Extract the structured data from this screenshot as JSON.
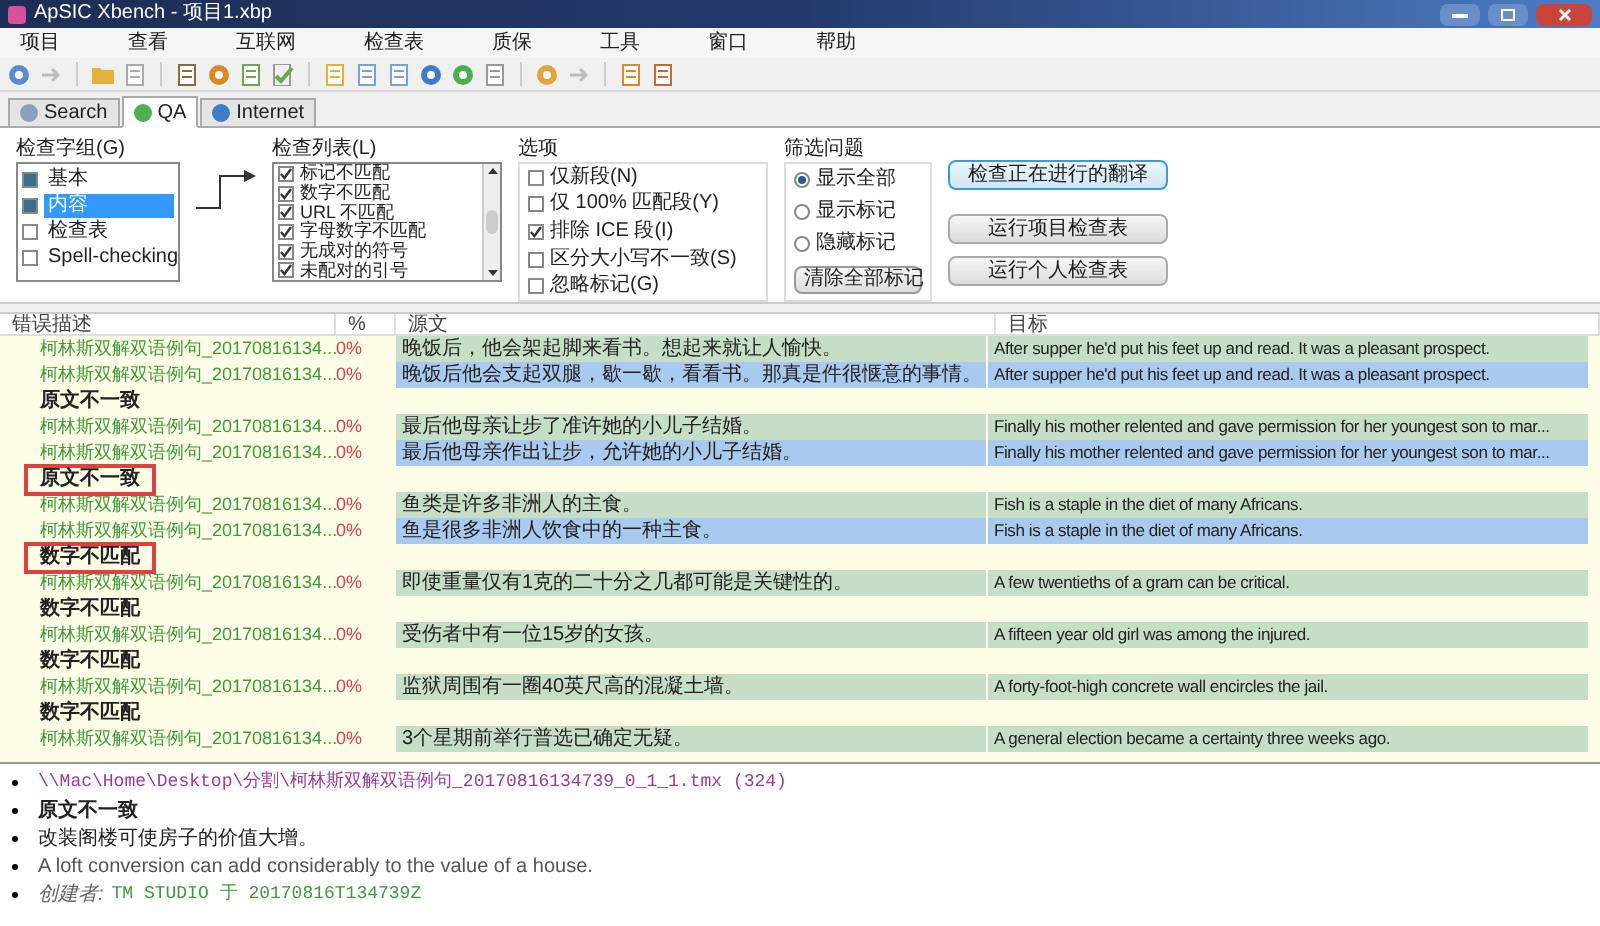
{
  "window": {
    "title": "ApSIC Xbench - 项目1.xbp"
  },
  "menu": [
    "项目",
    "查看",
    "互联网",
    "检查表",
    "质保",
    "工具",
    "窗口",
    "帮助"
  ],
  "tabs": [
    {
      "label": "Search",
      "selected": false
    },
    {
      "label": "QA",
      "selected": true
    },
    {
      "label": "Internet",
      "selected": false
    }
  ],
  "check_groups": {
    "label": "检查字组(G)",
    "items": [
      {
        "label": "基本",
        "checked": true,
        "selected": false
      },
      {
        "label": "内容",
        "checked": true,
        "selected": true
      },
      {
        "label": "检查表",
        "checked": false,
        "selected": false
      },
      {
        "label": "Spell-checking",
        "checked": false,
        "selected": false
      }
    ]
  },
  "check_list": {
    "label": "检查列表(L)",
    "items": [
      {
        "label": "标记不匹配",
        "checked": true
      },
      {
        "label": "数字不匹配",
        "checked": true
      },
      {
        "label": "URL 不匹配",
        "checked": true
      },
      {
        "label": "字母数字不匹配",
        "checked": true
      },
      {
        "label": "无成对的符号",
        "checked": true
      },
      {
        "label": "未配对的引号",
        "checked": true
      }
    ]
  },
  "options": {
    "label": "选项",
    "items": [
      {
        "label": "仅新段(N)",
        "checked": false
      },
      {
        "label": "仅 100% 匹配段(Y)",
        "checked": false
      },
      {
        "label": "排除 ICE 段(I)",
        "checked": true
      },
      {
        "label": "区分大小写不一致(S)",
        "checked": false
      },
      {
        "label": "忽略标记(G)",
        "checked": false
      }
    ]
  },
  "filter": {
    "label": "筛选问题",
    "items": [
      {
        "label": "显示全部",
        "selected": true
      },
      {
        "label": "显示标记",
        "selected": false
      },
      {
        "label": "隐藏标记",
        "selected": false
      }
    ],
    "clear_button": "清除全部标记"
  },
  "actions": [
    {
      "label": "检查正在进行的翻译",
      "focused": true
    },
    {
      "label": "运行项目检查表",
      "focused": false
    },
    {
      "label": "运行个人检查表",
      "focused": false
    }
  ],
  "table": {
    "columns": [
      "错误描述",
      "%",
      "源文",
      "目标"
    ],
    "rows": [
      {
        "kind": "segment",
        "file": "柯林斯双解双语例句_20170816134...",
        "percent": "0%",
        "source": "晚饭后，他会架起脚来看书。想起来就让人愉快。",
        "target": "After supper he'd put his feet up and read. It was a pleasant prospect.",
        "color": "#c7dec6"
      },
      {
        "kind": "segment",
        "file": "柯林斯双解双语例句_20170816134...",
        "percent": "0%",
        "source": "晚饭后他会支起双腿，歇一歇，看看书。那真是件很惬意的事情。",
        "target": "After supper he'd put his feet up and read. It was a pleasant prospect.",
        "color": "#a9c9ee"
      },
      {
        "kind": "group",
        "label": "原文不一致",
        "boxed": false
      },
      {
        "kind": "segment",
        "file": "柯林斯双解双语例句_20170816134...",
        "percent": "0%",
        "source": "最后他母亲让步了准许她的小儿子结婚。",
        "target": "Finally his mother relented and gave permission for her youngest son to mar...",
        "color": "#c7dec6"
      },
      {
        "kind": "segment",
        "file": "柯林斯双解双语例句_20170816134...",
        "percent": "0%",
        "source": "最后他母亲作出让步，允许她的小儿子结婚。",
        "target": "Finally his mother relented and gave permission for her youngest son to mar...",
        "color": "#a9c9ee"
      },
      {
        "kind": "group",
        "label": "原文不一致",
        "boxed": true
      },
      {
        "kind": "segment",
        "file": "柯林斯双解双语例句_20170816134...",
        "percent": "0%",
        "source": "鱼类是许多非洲人的主食。",
        "target": "Fish is a staple in the diet of many Africans.",
        "color": "#c7dec6"
      },
      {
        "kind": "segment",
        "file": "柯林斯双解双语例句_20170816134...",
        "percent": "0%",
        "source": "鱼是很多非洲人饮食中的一种主食。",
        "target": "Fish is a staple in the diet of many Africans.",
        "color": "#a9c9ee"
      },
      {
        "kind": "group",
        "label": "数字不匹配",
        "boxed": true
      },
      {
        "kind": "segment",
        "file": "柯林斯双解双语例句_20170816134...",
        "percent": "0%",
        "source": "即使重量仅有1克的二十分之几都可能是关键性的。",
        "target": "A few twentieths of a gram can be critical.",
        "color": "#c7dec6"
      },
      {
        "kind": "group",
        "label": "数字不匹配",
        "boxed": false
      },
      {
        "kind": "segment",
        "file": "柯林斯双解双语例句_20170816134...",
        "percent": "0%",
        "source": "受伤者中有一位15岁的女孩。",
        "target": "A fifteen year old girl was among the injured.",
        "color": "#c7dec6"
      },
      {
        "kind": "group",
        "label": "数字不匹配",
        "boxed": false
      },
      {
        "kind": "segment",
        "file": "柯林斯双解双语例句_20170816134...",
        "percent": "0%",
        "source": "监狱周围有一圈40英尺高的混凝土墙。",
        "target": "A forty-foot-high concrete wall encircles the jail.",
        "color": "#c7dec6"
      },
      {
        "kind": "group",
        "label": "数字不匹配",
        "boxed": false
      },
      {
        "kind": "segment",
        "file": "柯林斯双解双语例句_20170816134...",
        "percent": "0%",
        "source": "3个星期前举行普选已确定无疑。",
        "target": "A general election became a certainty three weeks ago.",
        "color": "#c7dec6"
      }
    ]
  },
  "details": [
    {
      "kind": "path",
      "text": "\\\\Mac\\Home\\Desktop\\分割\\柯林斯双解双语例句_20170816134739_0_1_1.tmx (324)"
    },
    {
      "kind": "error",
      "text": "原文不一致"
    },
    {
      "kind": "source",
      "text": "改装阁楼可使房子的价值大增。"
    },
    {
      "kind": "target",
      "text": "A loft conversion can add considerably to the value of a house."
    },
    {
      "kind": "creator",
      "label": "创建者:",
      "value": "TM STUDIO 于 20170816T134739Z"
    }
  ]
}
